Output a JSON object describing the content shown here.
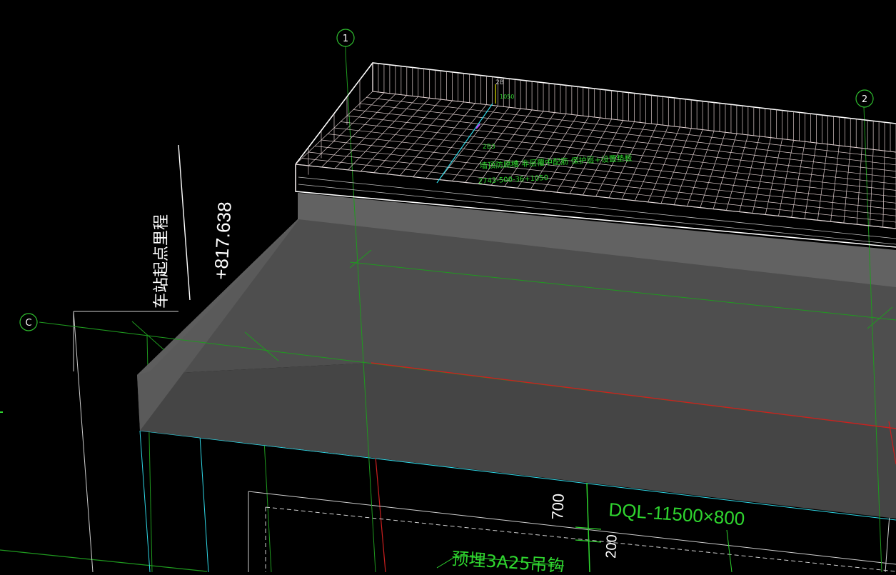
{
  "colors": {
    "background": "#000000",
    "axis_line": "#1f9a1f",
    "axis_bubble": "#2fbf2f",
    "red_line": "#cc1f1f",
    "cyan_line": "#2fd7e6",
    "text_green": "#2fd52f",
    "text_white": "#ffffff",
    "slab_top": "#4a4a4a",
    "slab_side": "#6a6a6a",
    "rebar_mesh": "#d9c8c8"
  },
  "axis_bubbles": [
    {
      "id": "1",
      "label": "1"
    },
    {
      "id": "2",
      "label": "2"
    },
    {
      "id": "c",
      "label": "C"
    }
  ],
  "mileage_label": "车站起点里程",
  "mileage_value": "+817.638",
  "member_label": "DQL-11500×800",
  "dim_700": "700",
  "dim_200": "200",
  "embed_label": "预埋3A25吊钩",
  "rebar_note_line1": "墙顶防腐槽 非层覆中配筋 保护层+设置垫板",
  "rebar_note_line2": "2743-500-36+1050",
  "rebar_tag_small": "2B",
  "rebar_tag_small2": "1050",
  "rebar_tag_small3": "2B3"
}
